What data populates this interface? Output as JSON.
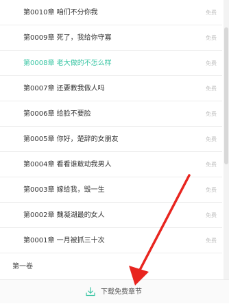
{
  "chapters": [
    {
      "title": "第0010章 咱们不分你我",
      "badge": "免费",
      "current": false
    },
    {
      "title": "第0009章 死了，我给你守寡",
      "badge": "免费",
      "current": false
    },
    {
      "title": "第0008章 老大做的不怎么样",
      "badge": "免费",
      "current": true
    },
    {
      "title": "第0007章 还要教我做人吗",
      "badge": "免费",
      "current": false
    },
    {
      "title": "第0006章 给脸不要脸",
      "badge": "免费",
      "current": false
    },
    {
      "title": "第0005章 你好，楚辞的女朋友",
      "badge": "免费",
      "current": false
    },
    {
      "title": "第0004章 看看谁敢动我男人",
      "badge": "免费",
      "current": false
    },
    {
      "title": "第0003章 嫁给我，毁一生",
      "badge": "免费",
      "current": false
    },
    {
      "title": "第0002章 魏凝湖最的女人",
      "badge": "免费",
      "current": false
    },
    {
      "title": "第0001章 一月被抓三十次",
      "badge": "免费",
      "current": false
    }
  ],
  "volume": {
    "label": "第一卷"
  },
  "bottom_bar": {
    "download_label": "下载免费章节",
    "icon": "download-icon"
  },
  "colors": {
    "accent": "#36c4a2",
    "text": "#333333",
    "badge": "#c2c2c2",
    "divider": "#ececec",
    "annotation_arrow": "#e8251f"
  }
}
